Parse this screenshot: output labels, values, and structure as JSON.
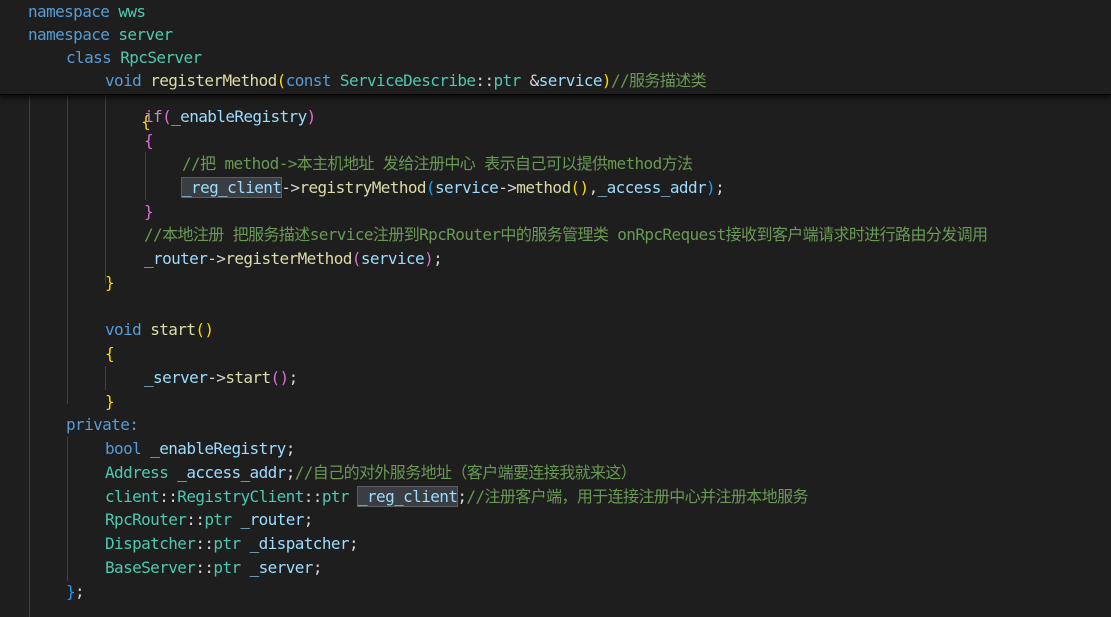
{
  "editor": {
    "sticky_lines": [
      [
        {
          "t": "namespace",
          "c": "kw"
        },
        {
          "t": " ",
          "c": "pl"
        },
        {
          "t": "wws",
          "c": "ty"
        }
      ],
      [
        {
          "t": "namespace",
          "c": "kw"
        },
        {
          "t": " ",
          "c": "pl"
        },
        {
          "t": "server",
          "c": "ty"
        }
      ],
      [
        {
          "t": "class",
          "c": "kw"
        },
        {
          "t": " ",
          "c": "pl"
        },
        {
          "t": "RpcServer",
          "c": "ty"
        }
      ],
      [
        {
          "t": "void",
          "c": "kw"
        },
        {
          "t": " ",
          "c": "pl"
        },
        {
          "t": "registerMethod",
          "c": "fn"
        },
        {
          "t": "(",
          "c": "b1"
        },
        {
          "t": "const",
          "c": "kw"
        },
        {
          "t": " ",
          "c": "pl"
        },
        {
          "t": "ServiceDescribe",
          "c": "ty"
        },
        {
          "t": "::",
          "c": "pl"
        },
        {
          "t": "ptr",
          "c": "ty"
        },
        {
          "t": " &",
          "c": "pl"
        },
        {
          "t": "service",
          "c": "var"
        },
        {
          "t": ")",
          "c": "b1"
        },
        {
          "t": "//服务描述类",
          "c": "cm"
        }
      ]
    ],
    "code_lines": [
      [
        {
          "t": "if",
          "c": "ctl"
        },
        {
          "t": "(",
          "c": "b2"
        },
        {
          "t": "_enableRegistry",
          "c": "var"
        },
        {
          "t": ")",
          "c": "b2"
        }
      ],
      [
        {
          "t": "{",
          "c": "b2"
        }
      ],
      [
        {
          "t": "//把 method->本主机地址 发给注册中心 表示自己可以提供method方法",
          "c": "cm"
        }
      ],
      [
        {
          "t": "_reg_client",
          "c": "var",
          "hl": true
        },
        {
          "t": "->",
          "c": "pl"
        },
        {
          "t": "registryMethod",
          "c": "fn"
        },
        {
          "t": "(",
          "c": "b3"
        },
        {
          "t": "service",
          "c": "var"
        },
        {
          "t": "->",
          "c": "pl"
        },
        {
          "t": "method",
          "c": "fn"
        },
        {
          "t": "()",
          "c": "b1"
        },
        {
          "t": ",",
          "c": "pl"
        },
        {
          "t": "_access_addr",
          "c": "var"
        },
        {
          "t": ")",
          "c": "b3"
        },
        {
          "t": ";",
          "c": "pl"
        }
      ],
      [
        {
          "t": "}",
          "c": "b2"
        }
      ],
      [
        {
          "t": "//本地注册 把服务描述service注册到RpcRouter中的服务管理类 onRpcRequest接收到客户端请求时进行路由分发调用",
          "c": "cm"
        }
      ],
      [
        {
          "t": "_router",
          "c": "var"
        },
        {
          "t": "->",
          "c": "pl"
        },
        {
          "t": "registerMethod",
          "c": "fn"
        },
        {
          "t": "(",
          "c": "b2"
        },
        {
          "t": "service",
          "c": "var"
        },
        {
          "t": ")",
          "c": "b2"
        },
        {
          "t": ";",
          "c": "pl"
        }
      ],
      [
        {
          "t": "}",
          "c": "b1"
        }
      ],
      [],
      [
        {
          "t": "void",
          "c": "kw"
        },
        {
          "t": " ",
          "c": "pl"
        },
        {
          "t": "start",
          "c": "fn"
        },
        {
          "t": "()",
          "c": "b1"
        }
      ],
      [
        {
          "t": "{",
          "c": "b1"
        }
      ],
      [
        {
          "t": "_server",
          "c": "var"
        },
        {
          "t": "->",
          "c": "pl"
        },
        {
          "t": "start",
          "c": "fn"
        },
        {
          "t": "()",
          "c": "b2"
        },
        {
          "t": ";",
          "c": "pl"
        }
      ],
      [
        {
          "t": "}",
          "c": "b1"
        }
      ],
      [
        {
          "t": "private:",
          "c": "kw"
        }
      ],
      [
        {
          "t": "bool",
          "c": "kw"
        },
        {
          "t": " ",
          "c": "pl"
        },
        {
          "t": "_enableRegistry",
          "c": "var"
        },
        {
          "t": ";",
          "c": "pl"
        }
      ],
      [
        {
          "t": "Address",
          "c": "ty"
        },
        {
          "t": " ",
          "c": "pl"
        },
        {
          "t": "_access_addr",
          "c": "var"
        },
        {
          "t": ";",
          "c": "pl"
        },
        {
          "t": "//自己的对外服务地址（客户端要连接我就来这）",
          "c": "cm"
        }
      ],
      [
        {
          "t": "client",
          "c": "ty"
        },
        {
          "t": "::",
          "c": "pl"
        },
        {
          "t": "RegistryClient",
          "c": "ty"
        },
        {
          "t": "::",
          "c": "pl"
        },
        {
          "t": "ptr",
          "c": "ty"
        },
        {
          "t": " ",
          "c": "pl"
        },
        {
          "t": "_reg_client",
          "c": "var",
          "hl": true
        },
        {
          "t": ";",
          "c": "pl"
        },
        {
          "t": "//注册客户端，用于连接注册中心并注册本地服务",
          "c": "cm"
        }
      ],
      [
        {
          "t": "RpcRouter",
          "c": "ty"
        },
        {
          "t": "::",
          "c": "pl"
        },
        {
          "t": "ptr",
          "c": "ty"
        },
        {
          "t": " ",
          "c": "pl"
        },
        {
          "t": "_router",
          "c": "var"
        },
        {
          "t": ";",
          "c": "pl"
        }
      ],
      [
        {
          "t": "Dispatcher",
          "c": "ty"
        },
        {
          "t": "::",
          "c": "pl"
        },
        {
          "t": "ptr",
          "c": "ty"
        },
        {
          "t": " ",
          "c": "pl"
        },
        {
          "t": "_dispatcher",
          "c": "var"
        },
        {
          "t": ";",
          "c": "pl"
        }
      ],
      [
        {
          "t": "BaseServer",
          "c": "ty"
        },
        {
          "t": "::",
          "c": "pl"
        },
        {
          "t": "ptr",
          "c": "ty"
        },
        {
          "t": " ",
          "c": "pl"
        },
        {
          "t": "_server",
          "c": "var"
        },
        {
          "t": ";",
          "c": "pl"
        }
      ],
      [
        {
          "t": "}",
          "c": "b3"
        },
        {
          "t": ";",
          "c": "pl"
        }
      ]
    ],
    "partial_brace": "{"
  }
}
